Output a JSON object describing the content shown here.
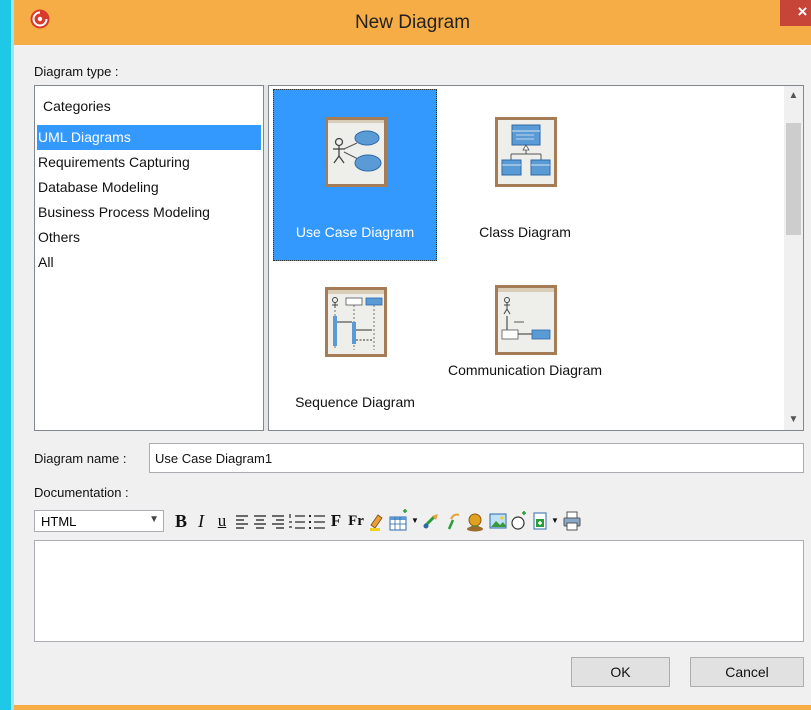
{
  "window": {
    "title": "New Diagram",
    "close_glyph": "×",
    "app_icon": "visual-paradigm-logo-icon"
  },
  "diagram_type": {
    "label": "Diagram type :",
    "categories_header": "Categories",
    "categories": [
      {
        "label": "UML Diagrams",
        "selected": true
      },
      {
        "label": "Requirements Capturing",
        "selected": false
      },
      {
        "label": "Database Modeling",
        "selected": false
      },
      {
        "label": "Business Process Modeling",
        "selected": false
      },
      {
        "label": "Others",
        "selected": false
      },
      {
        "label": "All",
        "selected": false
      }
    ],
    "types": [
      {
        "label": "Use Case Diagram",
        "selected": true,
        "icon": "use-case-diagram-icon"
      },
      {
        "label": "Class Diagram",
        "selected": false,
        "icon": "class-diagram-icon"
      },
      {
        "label": "Sequence Diagram",
        "selected": false,
        "icon": "sequence-diagram-icon"
      },
      {
        "label": "Communication Diagram",
        "selected": false,
        "icon": "communication-diagram-icon"
      }
    ]
  },
  "diagram_name": {
    "label": "Diagram name :",
    "value": "Use Case Diagram1"
  },
  "documentation": {
    "label": "Documentation :",
    "format_value": "HTML",
    "toolbar": {
      "bold": "B",
      "italic": "I",
      "underline": "u",
      "font": "F",
      "font_size": "Fr"
    },
    "toolbar_icons": [
      "bold-icon",
      "italic-icon",
      "underline-icon",
      "align-left-icon",
      "align-center-icon",
      "align-right-icon",
      "numbered-list-icon",
      "bullet-list-icon",
      "font-icon",
      "font-size-icon",
      "highlight-icon",
      "insert-table-icon",
      "link-icon",
      "unlink-icon",
      "insert-reference-icon",
      "insert-image-icon",
      "insert-shape-icon",
      "insert-file-icon",
      "print-icon"
    ],
    "text": ""
  },
  "buttons": {
    "ok": "OK",
    "cancel": "Cancel"
  },
  "colors": {
    "title_bar": "#f7ad45",
    "selection": "#3399ff",
    "close_button": "#c74538",
    "dialog_bg": "#f0f0f0"
  }
}
